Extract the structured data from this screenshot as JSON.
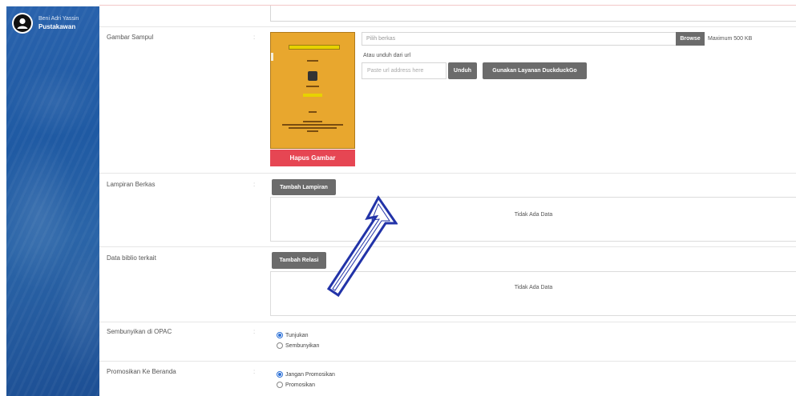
{
  "sidebar": {
    "user_name": "Beni Adri Yassin",
    "user_role": "Pustakawan"
  },
  "cover_field": {
    "label": "Gambar Sampul",
    "colon": ":",
    "delete_button": "Hapus Gambar",
    "file_placeholder": "Pilih berkas",
    "browse_button": "Browse",
    "max_size": "Maximum 500 KB",
    "url_label": "Atau unduh dari url",
    "url_placeholder": "Paste url address here",
    "download_button": "Unduh",
    "duckduckgo_button": "Gunakan Layanan DuckduckGo",
    "cover_title": "Judul Skripsi Jurusan Profesi"
  },
  "attachment_field": {
    "label": "Lampiran Berkas",
    "colon": ":",
    "add_button": "Tambah Lampiran",
    "empty_text": "Tidak Ada Data"
  },
  "related_field": {
    "label": "Data biblio terkait",
    "colon": ":",
    "add_button": "Tambah Relasi",
    "empty_text": "Tidak Ada Data"
  },
  "hide_field": {
    "label": "Sembunyikan di OPAC",
    "colon": ":",
    "options": [
      "Tunjukan",
      "Sembunyikan"
    ],
    "selected": "Tunjukan"
  },
  "promote_field": {
    "label": "Promosikan Ke Beranda",
    "colon": ":",
    "options": [
      "Jangan Promosikan",
      "Promosikan"
    ],
    "selected": "Jangan Promosikan"
  },
  "colors": {
    "sidebar": "#1f5aa3",
    "danger": "#e64653",
    "button_gray": "#6b6b6b",
    "annotation_arrow": "#2233a8"
  }
}
